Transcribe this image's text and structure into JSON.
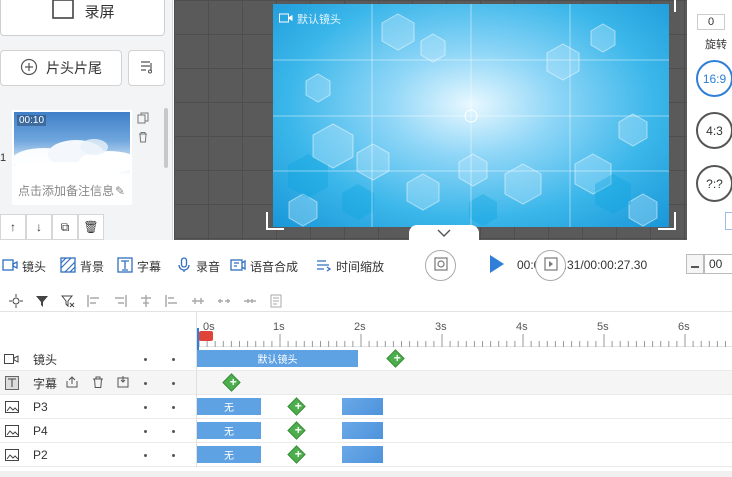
{
  "left_panel": {
    "record_label": "录屏",
    "title_credits_label": "片头片尾",
    "clip": {
      "index": "1",
      "duration": "00:10",
      "note_placeholder": "点击添加备注信息"
    }
  },
  "preview": {
    "canvas_label": "默认镜头"
  },
  "right_panel": {
    "rotation_value": "0",
    "rotation_label": "旋转",
    "ratios": [
      "16:9",
      "4:3",
      "?:?"
    ]
  },
  "toolbar": {
    "tools": [
      "镜头",
      "背景",
      "字幕",
      "录音",
      "语音合成",
      "时间缩放"
    ],
    "time_display": "00:00:00.31/00:00:27.30",
    "zoom_value": "00"
  },
  "timeline": {
    "ruler_ticks": [
      "0s",
      "1s",
      "2s",
      "3s",
      "4s",
      "5s",
      "6s"
    ],
    "tracks": [
      {
        "name": "镜头",
        "block_label": "默认镜头"
      },
      {
        "name": "字幕"
      },
      {
        "name": "P3",
        "block_label": "无"
      },
      {
        "name": "P4",
        "block_label": "无"
      },
      {
        "name": "P2",
        "block_label": "无"
      }
    ]
  },
  "colors": {
    "accent": "#2f7fd8",
    "keyframe_green": "#4cae4c",
    "block_blue": "#5ea2e4",
    "playhead_red": "#e0433a"
  }
}
